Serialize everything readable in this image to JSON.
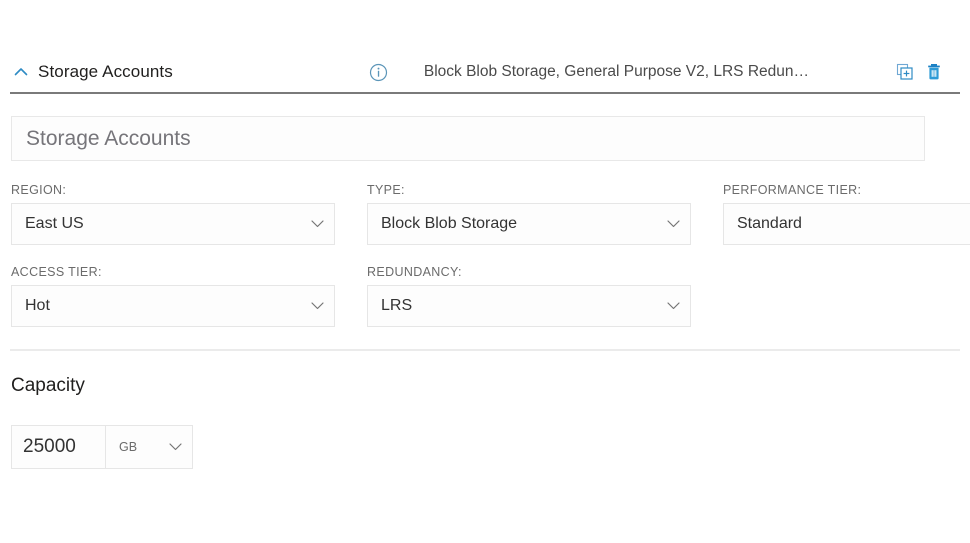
{
  "section": {
    "collapse_icon": "chevron-up-icon",
    "title": "Storage Accounts",
    "info_icon": "info-circle-icon",
    "summary": "Block Blob Storage, General Purpose V2, LRS Redun…",
    "actions": [
      {
        "name": "duplicate-button",
        "icon": "copy-add-icon"
      },
      {
        "name": "delete-button",
        "icon": "trash-icon"
      }
    ]
  },
  "name_field": {
    "value": "Storage Accounts",
    "placeholder": "Storage Accounts"
  },
  "fields": {
    "region": {
      "label": "REGION:",
      "value": "East US"
    },
    "type": {
      "label": "TYPE:",
      "value": "Block Blob Storage"
    },
    "performance_tier": {
      "label": "PERFORMANCE TIER:",
      "value": "Standard"
    },
    "access_tier": {
      "label": "ACCESS TIER:",
      "value": "Hot"
    },
    "redundancy": {
      "label": "REDUNDANCY:",
      "value": "LRS"
    }
  },
  "capacity": {
    "heading": "Capacity",
    "value": "25000",
    "unit": "GB"
  },
  "colors": {
    "accent_blue": "#0078d4",
    "icon_blue": "#2e8bc4",
    "label_grey": "#6b6b6b",
    "text_dark": "#201f1e",
    "border_grey": "#e6e6e6",
    "rule_dark": "#7a7a7a",
    "rule_light": "#ebebeb"
  }
}
